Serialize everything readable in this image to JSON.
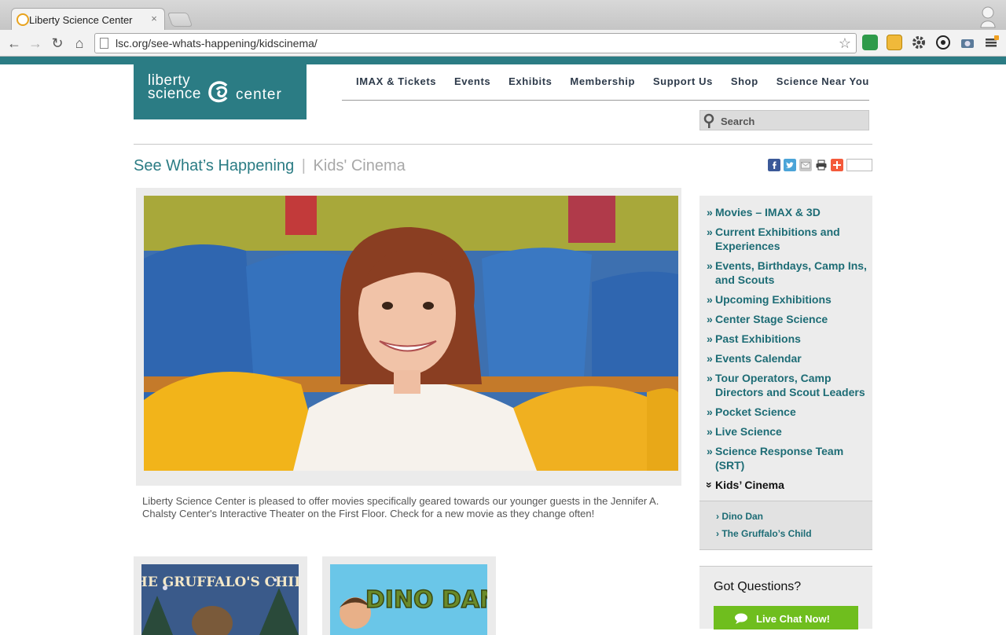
{
  "browser": {
    "tab_title": "Liberty Science Center",
    "tab_close": "×",
    "url": "lsc.org/see-whats-happening/kidscinema/",
    "nav": {
      "back": "←",
      "forward": "→",
      "reload": "↻",
      "home": "⌂"
    },
    "star": "☆"
  },
  "site": {
    "logo": {
      "line1": "liberty",
      "line2": "science",
      "line3": "center"
    },
    "nav": [
      "IMAX & Tickets",
      "Events",
      "Exhibits",
      "Membership",
      "Support Us",
      "Shop",
      "Science Near You"
    ],
    "search_placeholder": "Search",
    "breadcrumb": {
      "main": "See What’s Happening",
      "sep": "|",
      "current": "Kids' Cinema"
    },
    "share_icons": [
      "facebook-icon",
      "twitter-icon",
      "email-icon",
      "print-icon",
      "addthis-icon"
    ],
    "intro": "Liberty Science Center is pleased to offer movies specifically geared towards our younger guests in the Jennifer A. Chalsty Center's Interactive Theater on the First Floor. Check for a new movie as they change often!",
    "thumbnails": [
      {
        "title": "THE GRUFFALO'S CHILD"
      },
      {
        "title": "DINO DAN"
      }
    ],
    "sidebar": {
      "bullet": "»",
      "active_bullet": "»",
      "items": [
        "Movies – IMAX & 3D",
        "Current Exhibitions and Experiences",
        "Events, Birthdays, Camp Ins, and Scouts",
        "Upcoming Exhibitions",
        "Center Stage Science",
        "Past Exhibitions",
        "Events Calendar",
        "Tour Operators, Camp Directors and Scout Leaders",
        "Pocket Science",
        "Live Science",
        "Science Response Team (SRT)"
      ],
      "active_item": "Kids’ Cinema",
      "sub_bullet": "›",
      "sub_items": [
        "Dino Dan",
        "The Gruffalo’s Child"
      ]
    },
    "questions": {
      "title": "Got Questions?",
      "chat_button": "Live Chat Now!"
    },
    "colors": {
      "teal": "#2b7c84",
      "link": "#1d6c75",
      "chat_green": "#6fbe1e"
    }
  }
}
